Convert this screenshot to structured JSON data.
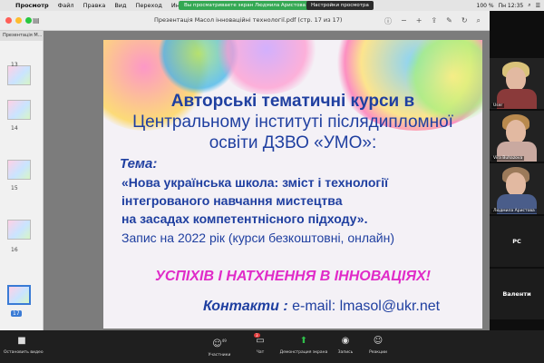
{
  "menubar": {
    "app": "Просмотр",
    "items": [
      "Файл",
      "Правка",
      "Вид",
      "Переход",
      "Инструменты"
    ],
    "share_notice": "Вы просматриваете экран Людмила Аристова",
    "share_options": "Настройки просмотра",
    "clock": "Пн 12:35",
    "battery": "100 %"
  },
  "preview": {
    "doc_title": "Презентація Масол інноваційні технології.pdf (стр. 17 из 17)",
    "sidebar_title": "Презентація М...",
    "pages": [
      "13",
      "14",
      "15",
      "16",
      "17"
    ],
    "selected_page": "17"
  },
  "slide": {
    "title_line1": "Авторські тематичні курси в",
    "title_line2": "Центральному інституті післядипломної",
    "title_line3": "освіти ДЗВО «УМО»:",
    "tema_label": "Тема:",
    "topic_line1": "«Нова українська школа: зміст і технології",
    "topic_line2": "інтегрованого навчання мистецтва",
    "topic_line3": "на засадах компетентнісного підходу».",
    "enroll": "Запис на 2022 рік (курси безкоштовні, онлайн)",
    "slogan": "УСПІХІВ І НАТХНЕННЯ В ІННОВАЦІЯХ!",
    "contacts_label": "Контакти :",
    "contacts_value": "e-mail:   lmasol@ukr.net"
  },
  "participants": [
    {
      "name": "User"
    },
    {
      "name": "Vira Buhazova"
    },
    {
      "name": "Людмила Аристова"
    },
    {
      "name": "PC"
    },
    {
      "name": "Валенти"
    }
  ],
  "zoom_toolbar": {
    "video": "Остановить видео",
    "participants": "Участники",
    "participants_count": "49",
    "chat": "Чат",
    "chat_badge": "3",
    "share": "Демонстрация экрана",
    "record": "Запись",
    "reactions": "Реакции"
  }
}
